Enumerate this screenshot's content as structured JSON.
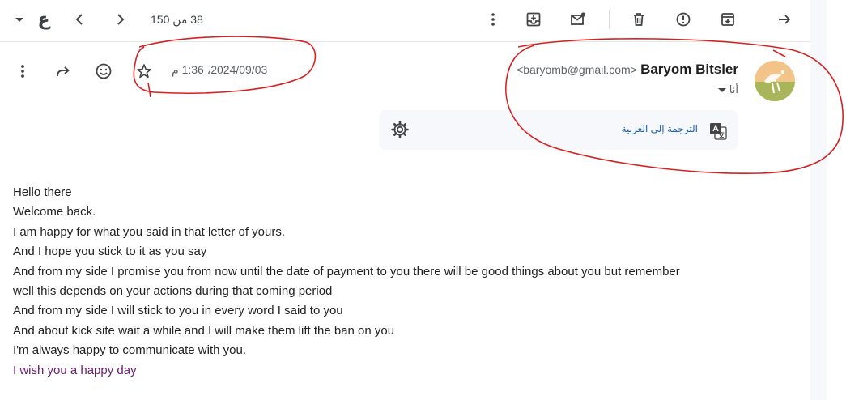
{
  "toolbar": {
    "lang_glyph": "ع",
    "pager_text": "38 من 150"
  },
  "message": {
    "date": "2024/09/03، 1:36 م",
    "sender_name": "Baryom Bitsler",
    "sender_email": "<baryomb@gmail.com>",
    "to_label": "أنا",
    "translate_label": "الترجمة إلى العربية"
  },
  "body": {
    "lines": [
      "Hello there",
      "Welcome back.",
      "I am happy for what you said in that letter of yours.",
      "And I hope you stick to it as you say",
      "And from my side I promise you from now until the date of payment to you there will be good things about you but remember",
      "well this depends on your actions during that coming period",
      "And from my side I will stick to you in every word I said to you",
      "And about kick site wait a while and I will make them lift the ban on you",
      "I'm always happy to communicate with you.",
      "I wish you a happy day"
    ]
  },
  "colors": {
    "annotation": "#d62020",
    "link": "#1a5fb4",
    "visited_text": "#681c6e",
    "translate_bg": "#f6f8fc"
  },
  "icons": {
    "toolbar": [
      "dropdown-caret-icon",
      "chevron-left-icon",
      "chevron-right-icon",
      "more-vert-icon",
      "move-to-inbox-icon",
      "mark-unread-icon",
      "delete-icon",
      "report-spam-icon",
      "archive-icon",
      "back-arrow-icon"
    ],
    "message": [
      "more-vert-icon",
      "forward-icon",
      "emoji-icon",
      "star-icon",
      "translate-icon",
      "settings-icon"
    ]
  }
}
